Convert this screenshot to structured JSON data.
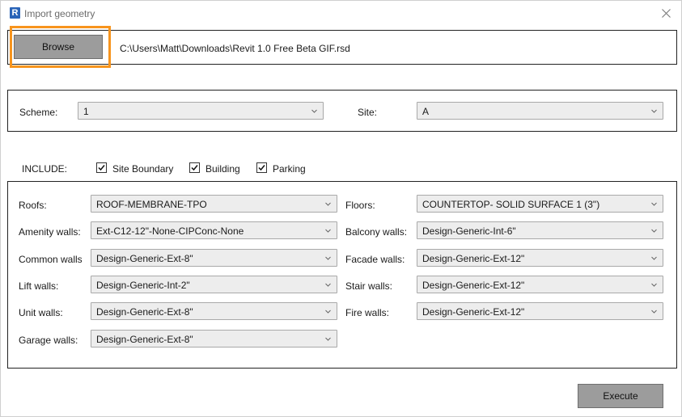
{
  "window": {
    "title": "Import geometry",
    "app_icon_letter": "R"
  },
  "file": {
    "browse_label": "Browse",
    "path": "C:\\Users\\Matt\\Downloads\\Revit 1.0 Free Beta GIF.rsd"
  },
  "selection": {
    "scheme_label": "Scheme:",
    "scheme_value": "1",
    "site_label": "Site:",
    "site_value": "A"
  },
  "include": {
    "label": "INCLUDE:",
    "options": [
      {
        "label": "Site Boundary",
        "checked": true
      },
      {
        "label": "Building",
        "checked": true
      },
      {
        "label": "Parking",
        "checked": true
      }
    ]
  },
  "types": {
    "left": [
      {
        "label": "Roofs:",
        "value": "ROOF-MEMBRANE-TPO"
      },
      {
        "label": "Amenity walls:",
        "value": "Ext-C12-12\"-None-CIPConc-None"
      },
      {
        "label": "Common walls",
        "value": "Design-Generic-Ext-8\""
      },
      {
        "label": "Lift walls:",
        "value": "Design-Generic-Int-2\""
      },
      {
        "label": "Unit walls:",
        "value": "Design-Generic-Ext-8\""
      },
      {
        "label": "Garage walls:",
        "value": "Design-Generic-Ext-8\""
      }
    ],
    "right": [
      {
        "label": "Floors:",
        "value": "COUNTERTOP- SOLID SURFACE 1 (3\")"
      },
      {
        "label": "Balcony walls:",
        "value": "Design-Generic-Int-6\""
      },
      {
        "label": "Facade walls:",
        "value": "Design-Generic-Ext-12\""
      },
      {
        "label": "Stair walls:",
        "value": "Design-Generic-Ext-12\""
      },
      {
        "label": "Fire walls:",
        "value": "Design-Generic-Ext-12\""
      }
    ]
  },
  "actions": {
    "execute_label": "Execute"
  },
  "colors": {
    "highlight": "#f7941d",
    "button": "#9c9c9c",
    "app_icon": "#2a64b8"
  },
  "icons": [
    "app-icon",
    "close-icon",
    "chevron-down-icon",
    "checkmark-icon"
  ]
}
